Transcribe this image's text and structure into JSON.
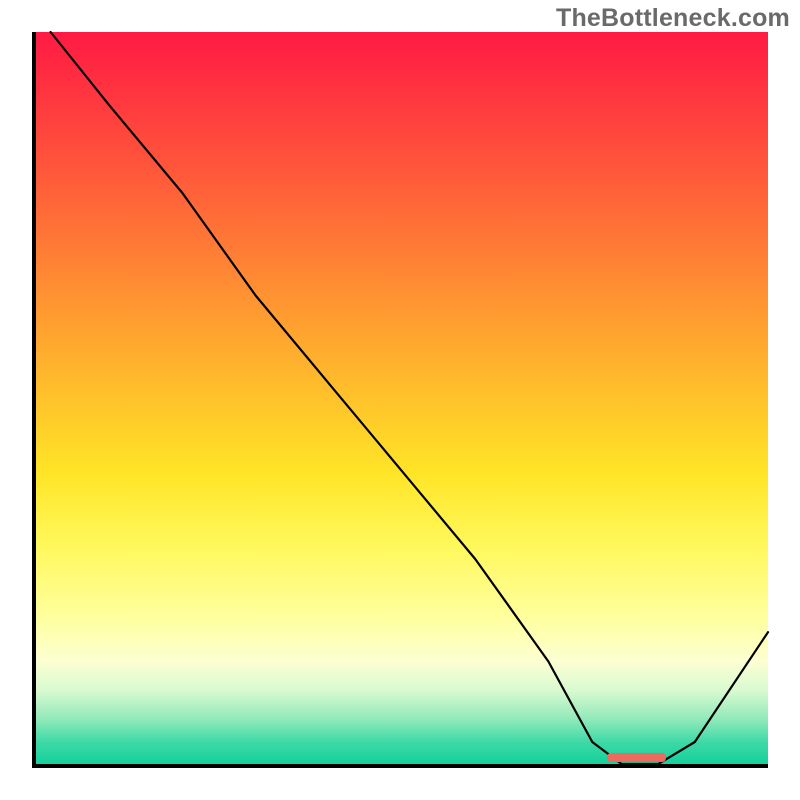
{
  "watermark": "TheBottleneck.com",
  "chart_data": {
    "type": "line",
    "title": "",
    "xlabel": "",
    "ylabel": "",
    "xlim": [
      0,
      100
    ],
    "ylim": [
      0,
      100
    ],
    "grid": false,
    "legend": false,
    "series": [
      {
        "name": "bottleneck-curve",
        "x": [
          2,
          10,
          20,
          30,
          40,
          50,
          60,
          70,
          76,
          80,
          85,
          90,
          100
        ],
        "values": [
          100,
          90,
          78,
          64,
          52,
          40,
          28,
          14,
          3,
          0,
          0,
          3,
          18
        ]
      }
    ],
    "markers": [
      {
        "name": "optimal-range",
        "x_start": 78,
        "x_end": 86,
        "y": 0
      }
    ],
    "gradient_stops": [
      {
        "pct": 0,
        "color": "#ff1a44"
      },
      {
        "pct": 50,
        "color": "#ffc22b"
      },
      {
        "pct": 80,
        "color": "#ffff9e"
      },
      {
        "pct": 100,
        "color": "#14d09b"
      }
    ]
  }
}
